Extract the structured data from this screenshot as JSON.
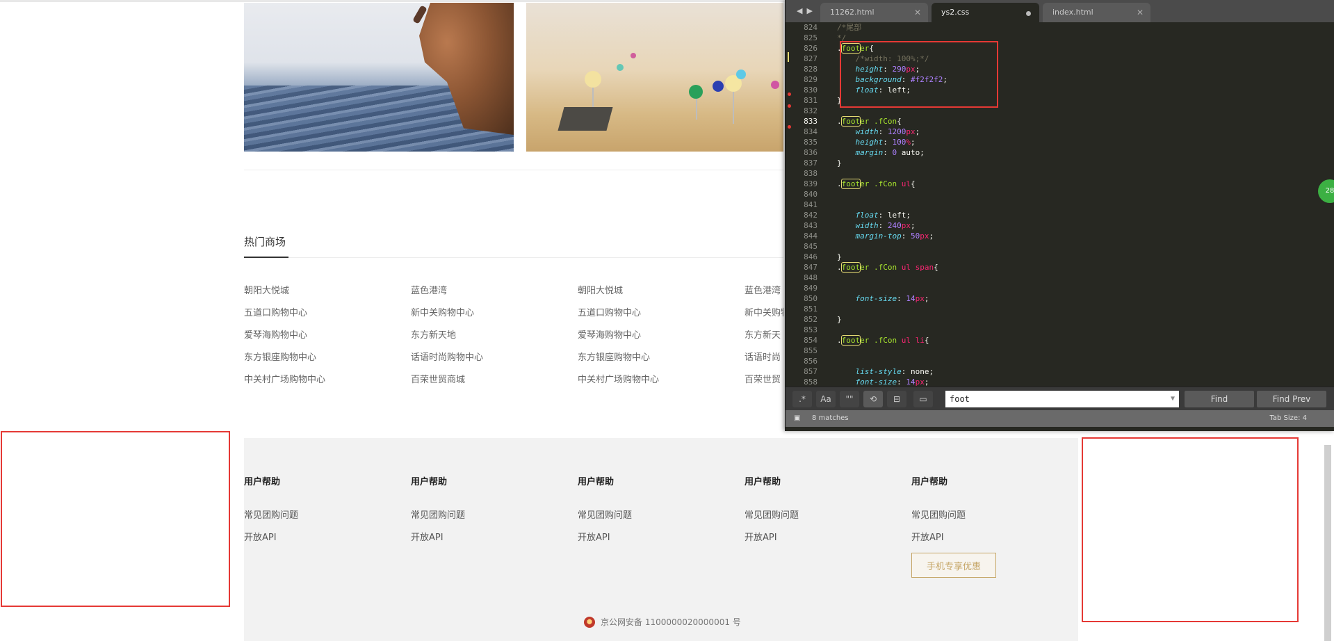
{
  "hot_malls": {
    "title": "热门商场",
    "columns": [
      [
        "朝阳大悦城",
        "五道口购物中心",
        "爱琴海购物中心",
        "东方银座购物中心",
        "中关村广场购物中心"
      ],
      [
        "蓝色港湾",
        "新中关购物中心",
        "东方新天地",
        "话语时尚购物中心",
        "百荣世贸商城"
      ],
      [
        "朝阳大悦城",
        "五道口购物中心",
        "爱琴海购物中心",
        "东方银座购物中心",
        "中关村广场购物中心"
      ],
      [
        "蓝色港湾",
        "新中关购物",
        "东方新天",
        "话语时尚",
        "百荣世贸"
      ]
    ]
  },
  "footer": {
    "columns": [
      {
        "heading": "用户帮助",
        "links": [
          "常见团购问题",
          "开放API"
        ]
      },
      {
        "heading": "用户帮助",
        "links": [
          "常见团购问题",
          "开放API"
        ]
      },
      {
        "heading": "用户帮助",
        "links": [
          "常见团购问题",
          "开放API"
        ]
      },
      {
        "heading": "用户帮助",
        "links": [
          "常见团购问题",
          "开放API"
        ]
      },
      {
        "heading": "用户帮助",
        "links": [
          "常见团购问题",
          "开放API"
        ]
      }
    ],
    "mobile_button": "手机专享优惠",
    "beian": "京公网安备 1100000020000001 号"
  },
  "editor": {
    "tabs": [
      {
        "name": "11262.html",
        "active": false,
        "modified": false
      },
      {
        "name": "ys2.css",
        "active": true,
        "modified": true
      },
      {
        "name": "index.html",
        "active": false,
        "modified": false
      }
    ],
    "line_numbers": [
      "824",
      "825",
      "826",
      "827",
      "828",
      "829",
      "830",
      "831",
      "832",
      "833",
      "834",
      "835",
      "836",
      "837",
      "838",
      "839",
      "840",
      "841",
      "842",
      "843",
      "844",
      "845",
      "846",
      "847",
      "848",
      "849",
      "850",
      "851",
      "852",
      "853",
      "854",
      "855",
      "856",
      "857",
      "858"
    ],
    "current_line": "833",
    "find": {
      "query": "foot",
      "find_label": "Find",
      "find_prev_label": "Find Prev",
      "options": [
        ".*",
        "Aa",
        "\"\""
      ]
    },
    "status": {
      "matches": "8 matches",
      "tab_size": "Tab Size: 4"
    },
    "badge": "28"
  }
}
